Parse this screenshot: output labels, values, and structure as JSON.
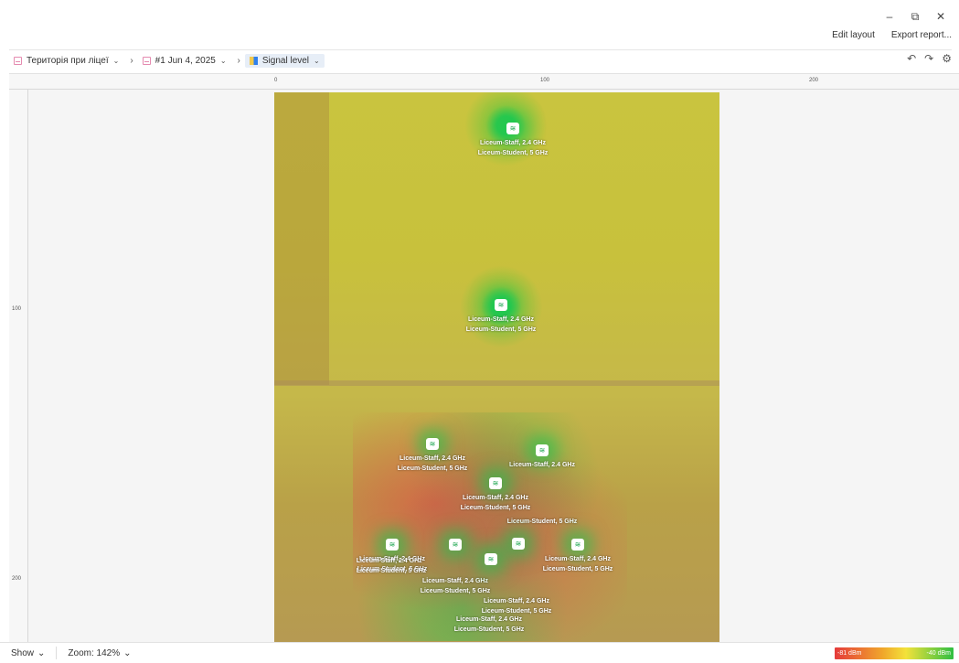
{
  "window": {
    "minimize": "–",
    "restore": "⧉",
    "close": "✕"
  },
  "top_actions": {
    "edit_layout": "Edit layout",
    "export_report": "Export report..."
  },
  "breadcrumb": [
    {
      "label": "Територія при ліцеї",
      "icon": "floorplan-icon"
    },
    {
      "label": "#1 Jun 4, 2025",
      "icon": "survey-icon"
    },
    {
      "label": "Signal level",
      "icon": "signal-level-icon"
    }
  ],
  "toolbar_icons": {
    "undo": "↶",
    "redo": "↷",
    "settings": "⚙"
  },
  "ruler": {
    "top": [
      "0",
      "100",
      "200"
    ],
    "left": [
      "100",
      "200"
    ]
  },
  "access_points": [
    {
      "lines": [
        "Liceum-Staff, 2.4 GHz",
        "Liceum-Student, 5 GHz"
      ]
    },
    {
      "lines": [
        "Liceum-Staff, 2.4 GHz",
        "Liceum-Student, 5 GHz"
      ]
    },
    {
      "lines": [
        "Liceum-Staff, 2.4 GHz",
        "Liceum-Student, 5 GHz"
      ]
    },
    {
      "lines": [
        "Liceum-Staff, 2.4 GHz"
      ]
    },
    {
      "lines": [
        "Liceum-Staff, 2.4 GHz",
        "Liceum-Student, 5 GHz",
        "Liceum-Student, 5 GHz"
      ]
    },
    {
      "lines": [
        "Liceum-Staff, 2.4 GHz",
        "Liceum-Student, 5 GHz"
      ]
    },
    {
      "lines": [
        "Liceum-Staff, 2.4 GHz",
        "Liceum-Student, 5 GHz"
      ]
    },
    {
      "lines": [
        "Liceum-Staff, 2.4 GHz",
        "Liceum-Student, 5 GHz"
      ]
    },
    {
      "lines": [
        "Liceum-Staff, 2.4 GHz",
        "Liceum-Student, 5 GHz"
      ]
    },
    {
      "lines": [
        "Liceum-Staff, 2.4 GHz",
        "Liceum-Student, 5 GHz"
      ]
    },
    {
      "lines": [
        "Liceum-Staff, 2.4 GHz",
        "Liceum-Student, 5 GHz"
      ]
    }
  ],
  "statusbar": {
    "show": "Show",
    "zoom": "Zoom: 142%"
  },
  "legend": {
    "min": "-81 dBm",
    "max": "-40 dBm"
  },
  "colors": {
    "weak": "#e53b3b",
    "strong": "#2fbf43",
    "accent": "#2f80ed"
  }
}
